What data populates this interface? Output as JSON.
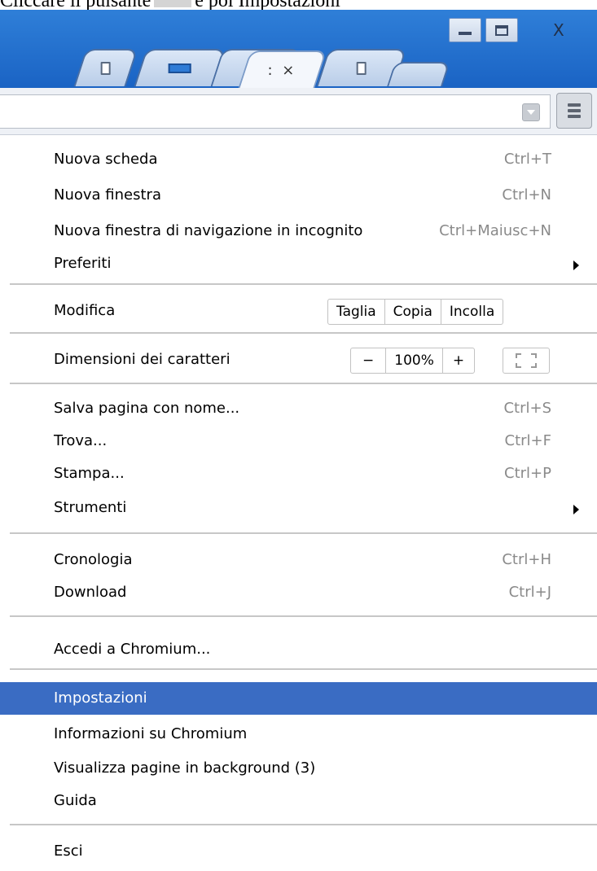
{
  "caption": {
    "before": "Cliccare il pulsante",
    "after": "e poi Impostazioni"
  },
  "window": {
    "close_label": "X"
  },
  "tabs": {
    "active_label": ": ×"
  },
  "menu": {
    "new_tab": {
      "label": "Nuova scheda",
      "shortcut": "Ctrl+T"
    },
    "new_window": {
      "label": "Nuova finestra",
      "shortcut": "Ctrl+N"
    },
    "incognito": {
      "label": "Nuova finestra di navigazione in incognito",
      "shortcut": "Ctrl+Maiusc+N"
    },
    "bookmarks": {
      "label": "Preferiti"
    },
    "edit": {
      "label": "Modifica",
      "cut": "Taglia",
      "copy": "Copia",
      "paste": "Incolla"
    },
    "zoom": {
      "label": "Dimensioni dei caratteri",
      "minus": "−",
      "value": "100%",
      "plus": "+"
    },
    "save_page": {
      "label": "Salva pagina con nome...",
      "shortcut": "Ctrl+S"
    },
    "find": {
      "label": "Trova...",
      "shortcut": "Ctrl+F"
    },
    "print": {
      "label": "Stampa...",
      "shortcut": "Ctrl+P"
    },
    "tools": {
      "label": "Strumenti"
    },
    "history": {
      "label": "Cronologia",
      "shortcut": "Ctrl+H"
    },
    "downloads": {
      "label": "Download",
      "shortcut": "Ctrl+J"
    },
    "sign_in": {
      "label": "Accedi a Chromium..."
    },
    "settings": {
      "label": "Impostazioni"
    },
    "about": {
      "label": "Informazioni su Chromium"
    },
    "background_pages": {
      "label": "Visualizza pagine in background (3)"
    },
    "help": {
      "label": "Guida"
    },
    "exit": {
      "label": "Esci"
    }
  },
  "colors": {
    "highlight": "#3a6cc3",
    "titlebar": "#2f7fd8",
    "shortcut_text": "#8a8a8a"
  }
}
